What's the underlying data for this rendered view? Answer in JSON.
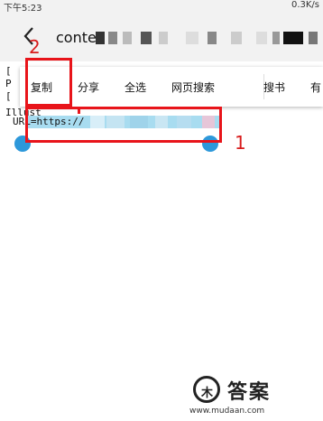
{
  "status_bar": {
    "time": "下午5:23",
    "net_speed": "0.3K/s"
  },
  "header": {
    "title": "conte",
    "back_icon": "chevron-left-icon"
  },
  "content_lines": [
    "[",
    "P",
    "[",
    "Illust",
    "URL=https://"
  ],
  "context_menu": {
    "items": [
      {
        "label": "复制"
      },
      {
        "label": "分享"
      },
      {
        "label": "全选"
      },
      {
        "label": "网页搜索"
      },
      {
        "label": "搜书"
      },
      {
        "label": "有"
      }
    ]
  },
  "selection": {
    "text": "URL=https://",
    "handle_color": "#2d98da",
    "highlight_color": "#a8dcf0"
  },
  "annotations": {
    "label_1": "1",
    "label_2": "2",
    "color": "#e8141a"
  },
  "watermark": {
    "logo_text": "木",
    "title": "答案",
    "url": "www.mudaan.com"
  }
}
